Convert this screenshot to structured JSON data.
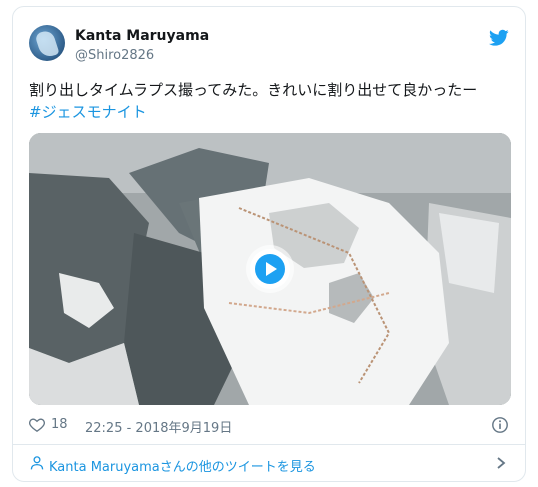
{
  "author": {
    "name": "Kanta Maruyama",
    "handle": "@Shiro2826"
  },
  "tweet": {
    "text": "割り出しタイムラプス撮ってみた。きれいに割り出せて良かったー",
    "hashtag": "#ジェスモナイト"
  },
  "meta": {
    "likes": "18",
    "timestamp": "22:25 - 2018年9月19日"
  },
  "footer": {
    "link_text": "Kanta Maruyamaさんの他のツイートを見る"
  },
  "colors": {
    "accent": "#1da1f2",
    "link": "#1b95e0",
    "muted": "#657786",
    "border": "#e1e8ed"
  },
  "icons": [
    "twitter-bird-icon",
    "play-icon",
    "heart-icon",
    "info-icon",
    "person-icon",
    "chevron-right-icon"
  ]
}
